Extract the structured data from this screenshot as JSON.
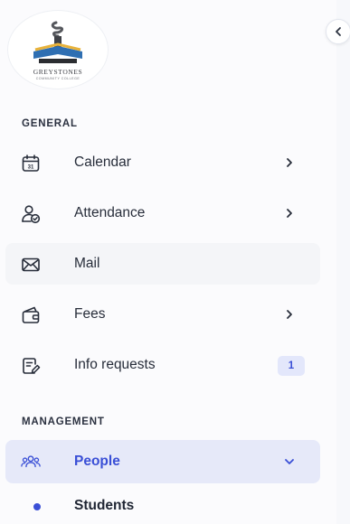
{
  "brand": {
    "name": "GREYSTONES",
    "subtitle": "COMMUNITY COLLEGE"
  },
  "sections": {
    "general": "GENERAL",
    "management": "MANAGEMENT"
  },
  "nav": {
    "calendar": {
      "label": "Calendar",
      "icon": "calendar-icon",
      "icon_text": "31"
    },
    "attendance": {
      "label": "Attendance",
      "icon": "user-check-icon"
    },
    "mail": {
      "label": "Mail",
      "icon": "envelope-icon"
    },
    "fees": {
      "label": "Fees",
      "icon": "wallet-icon"
    },
    "info_requests": {
      "label": "Info requests",
      "icon": "document-edit-icon",
      "badge": "1"
    },
    "people": {
      "label": "People",
      "icon": "people-icon"
    },
    "students": {
      "label": "Students"
    }
  },
  "colors": {
    "accent": "#3a4fd6",
    "active_bg": "#e6e9f9",
    "badge_bg": "#e3e7fb"
  }
}
